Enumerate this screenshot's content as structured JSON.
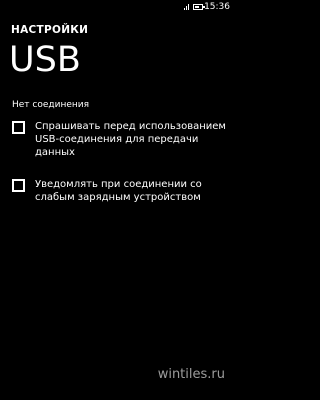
{
  "status_bar": {
    "time": "15:36",
    "signal_icon": "signal-bars-icon",
    "battery_icon": "battery-icon",
    "battery_level": 0.6
  },
  "header": {
    "app_title": "НАСТРОЙКИ",
    "page_title": "USB"
  },
  "main": {
    "connection_status": "Нет соединения",
    "options": [
      {
        "label": "Спрашивать перед использованием USB-соединения для передачи данных",
        "checked": false
      },
      {
        "label": "Уведомлять при соединении со слабым зарядным устройством",
        "checked": false
      }
    ]
  },
  "watermark": "wintiles.ru",
  "colors": {
    "background": "#000000",
    "foreground": "#ffffff"
  }
}
